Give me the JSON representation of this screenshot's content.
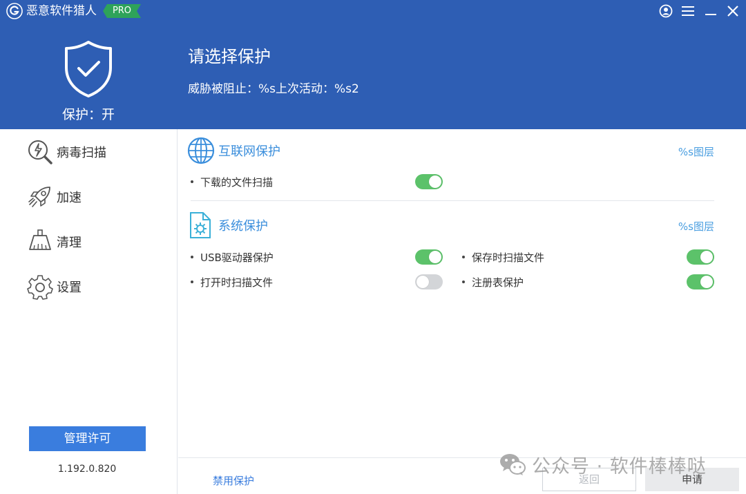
{
  "app": {
    "title": "恶意软件猎人",
    "badge": "PRO"
  },
  "header": {
    "status": "保护：开",
    "heading": "请选择保护",
    "subline": "威胁被阻止：%s上次活动：%s2"
  },
  "sidebar": {
    "items": [
      {
        "label": "病毒扫描",
        "icon": "virus-scan-icon"
      },
      {
        "label": "加速",
        "icon": "rocket-icon"
      },
      {
        "label": "清理",
        "icon": "broom-icon"
      },
      {
        "label": "设置",
        "icon": "gear-icon"
      }
    ],
    "license_button": "管理许可",
    "version": "1.192.0.820"
  },
  "sections": {
    "internet": {
      "title": "互联网保护",
      "layer_link": "%s图层",
      "options": [
        {
          "label": "下载的文件扫描",
          "enabled": true
        }
      ]
    },
    "system": {
      "title": "系统保护",
      "layer_link": "%s图层",
      "options": [
        {
          "label": "USB驱动器保护",
          "enabled": true
        },
        {
          "label": "保存时扫描文件",
          "enabled": true
        },
        {
          "label": "打开时扫描文件",
          "enabled": false
        },
        {
          "label": "注册表保护",
          "enabled": true
        }
      ]
    }
  },
  "footer": {
    "disable_link": "禁用保护",
    "back_button": "返回",
    "apply_button": "申请"
  },
  "watermark": {
    "text": "公众号 · 软件棒棒哒"
  },
  "colors": {
    "header_bg": "#2e5eb4",
    "accent": "#3a7dde",
    "toggle_on": "#5cc26a",
    "toggle_off": "#d3d5d8",
    "pro_badge": "#2ea35a"
  }
}
